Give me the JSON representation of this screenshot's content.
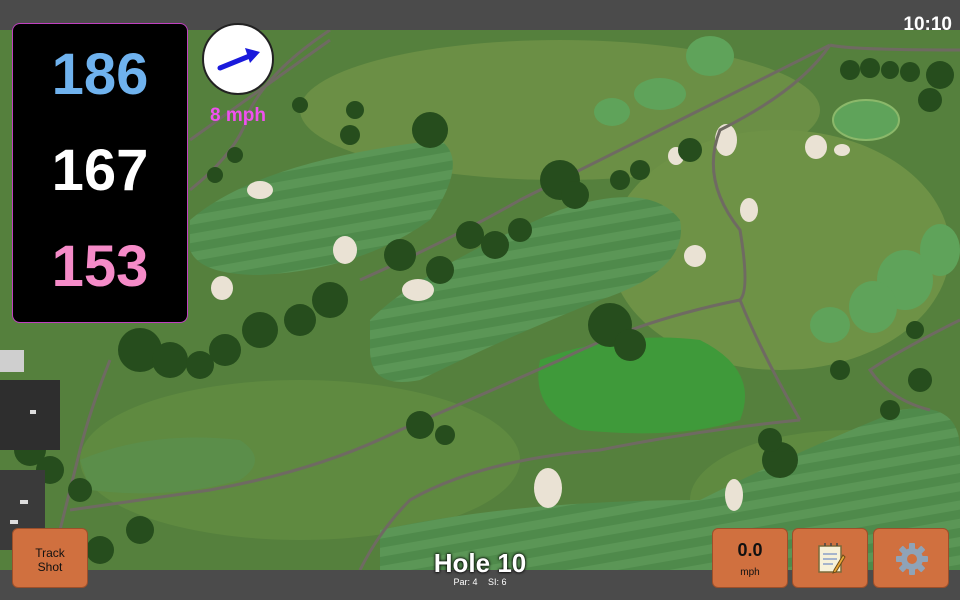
{
  "status": {
    "time": "10:10"
  },
  "distances": {
    "back": "186",
    "middle": "167",
    "front": "153"
  },
  "wind": {
    "speed_label": "8 mph",
    "direction_icon": "arrow-right-icon",
    "arrow_color": "#1a1adc"
  },
  "hole": {
    "title": "Hole 10",
    "par": "Par: 4",
    "stroke_index": "SI: 6"
  },
  "buttons": {
    "track_shot": {
      "line1": "Track",
      "line2": "Shot"
    },
    "speed": {
      "value": "0.0",
      "unit": "mph"
    },
    "notes": {
      "icon": "notepad-icon"
    },
    "settings": {
      "icon": "gear-icon"
    }
  },
  "colors": {
    "button": "#d0703f",
    "back_distance": "#6fb2ee",
    "middle_distance": "#ffffff",
    "front_distance": "#f58bc8",
    "wind_text": "#f050f0"
  }
}
